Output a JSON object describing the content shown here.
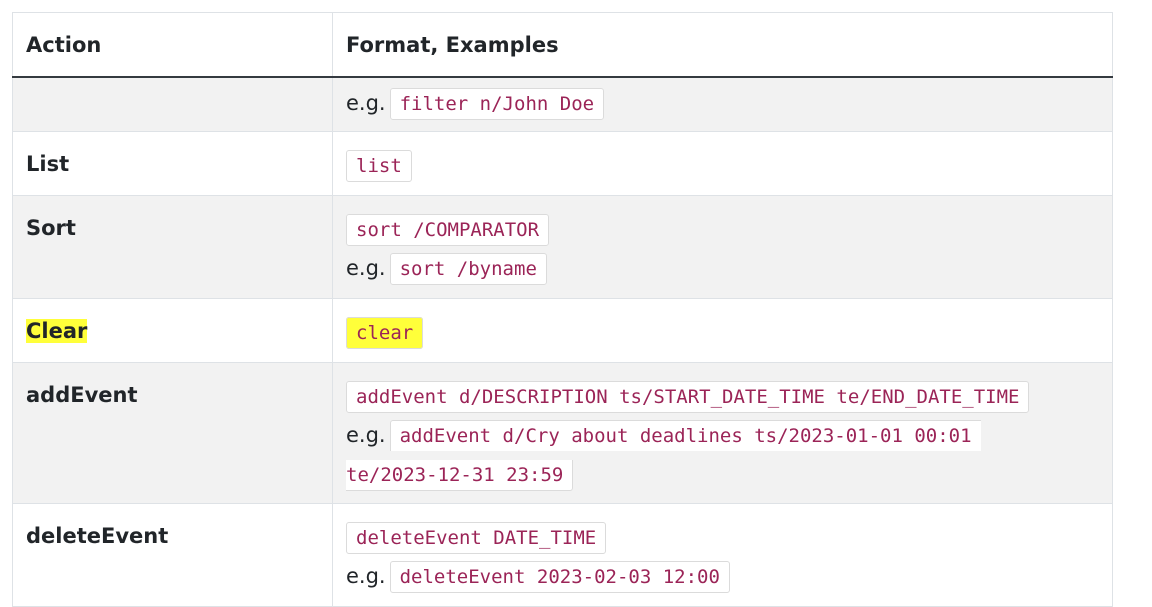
{
  "table": {
    "headers": {
      "action": "Action",
      "format": "Format, Examples"
    },
    "rows": [
      {
        "action": "",
        "format": null,
        "example_prefix": "e.g.",
        "example": "filter n/John Doe"
      },
      {
        "action": "List",
        "format": "list",
        "example_prefix": null,
        "example": null
      },
      {
        "action": "Sort",
        "format": "sort /COMPARATOR",
        "example_prefix": "e.g.",
        "example": "sort /byname"
      },
      {
        "action": "Clear",
        "format": "clear",
        "example_prefix": null,
        "example": null,
        "highlighted": true
      },
      {
        "action": "addEvent",
        "format": "addEvent d/DESCRIPTION ts/START_DATE_TIME te/END_DATE_TIME",
        "example_prefix": "e.g.",
        "example_line1": "addEvent d/Cry about deadlines ts/2023-01-01 00:01",
        "example_line2": "te/2023-12-31 23:59"
      },
      {
        "action": "deleteEvent",
        "format": "deleteEvent DATE_TIME",
        "example_prefix": "e.g.",
        "example": "deleteEvent 2023-02-03 12:00"
      }
    ]
  },
  "colors": {
    "code_text": "#9b2457",
    "highlight": "#ffff3a",
    "stripe": "#f2f2f2"
  }
}
